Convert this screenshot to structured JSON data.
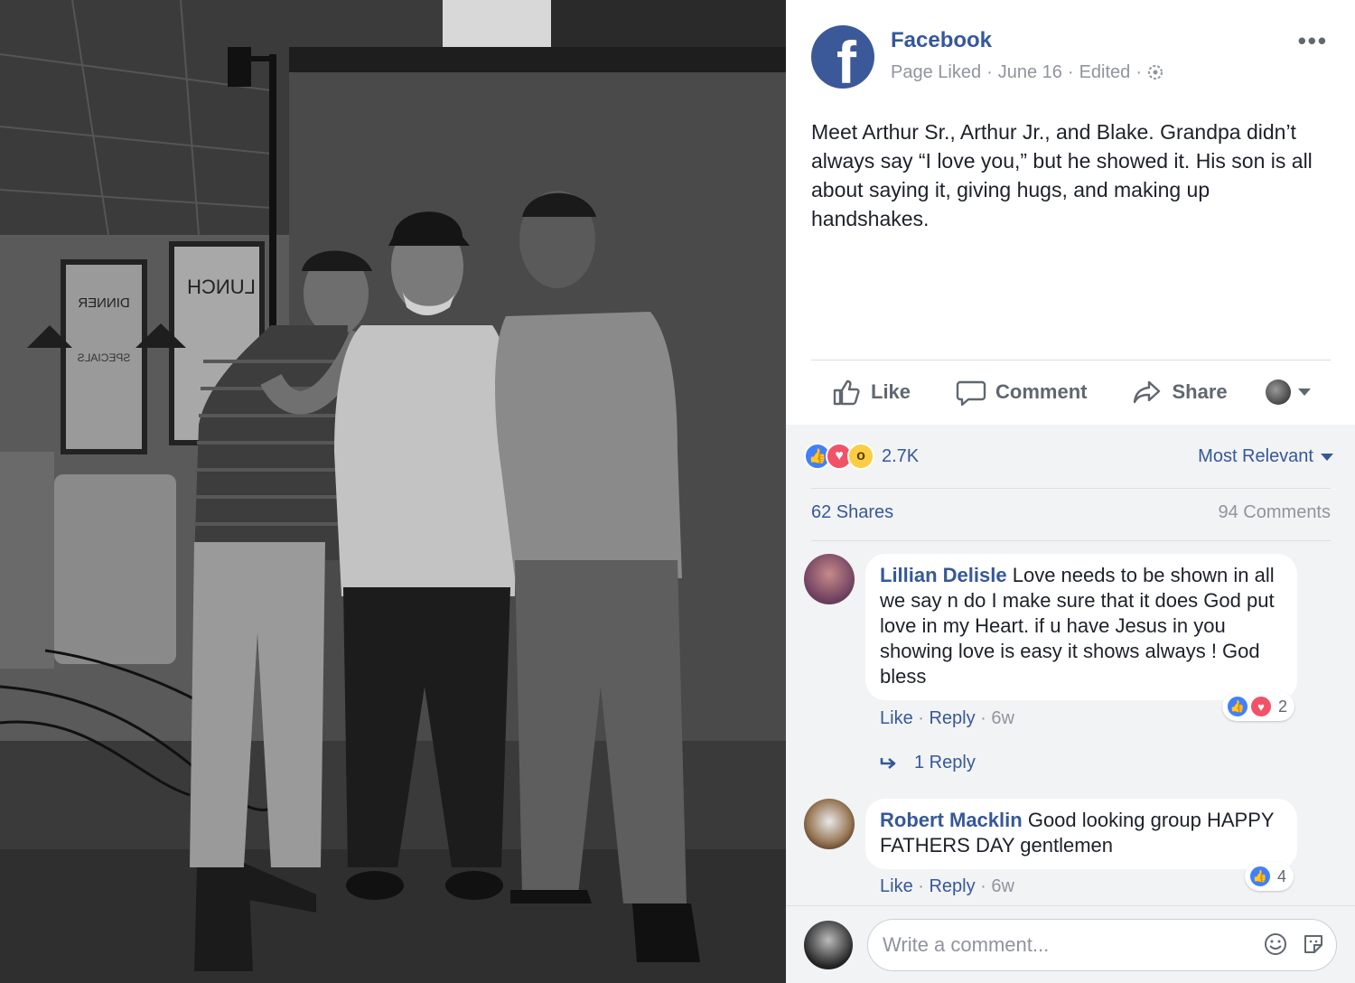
{
  "post": {
    "page_name": "Facebook",
    "logo_letter": "f",
    "status": "Page Liked",
    "date": "June 16",
    "edited": "Edited",
    "sep": "·",
    "more": "•••",
    "text": "Meet Arthur Sr., Arthur Jr., and Blake. Grandpa didn’t always say “I love you,” but he showed it. His son is all about saying it, giving hugs, and making up handshakes."
  },
  "actions": {
    "like": "Like",
    "comment": "Comment",
    "share": "Share"
  },
  "reactions": {
    "count": "2.7K",
    "sort": "Most Relevant",
    "shares": "62 Shares",
    "comments": "94 Comments"
  },
  "comments": [
    {
      "author": "Lillian Delisle",
      "text": "Love needs to be shown in all we say n do I make sure that it does God put love in my Heart. if u have Jesus in you showing love is easy it shows always ! God bless",
      "like": "Like",
      "reply": "Reply",
      "age": "6w",
      "reaction_count": "2",
      "replies_label": "1 Reply"
    },
    {
      "author": "Robert Macklin",
      "text": "Good looking group HAPPY FATHERS DAY gentlemen",
      "like": "Like",
      "reply": "Reply",
      "age": "6w",
      "reaction_count": "4"
    }
  ],
  "composer": {
    "placeholder": "Write a comment..."
  },
  "photo": {
    "sign_lunch": "LUNCH",
    "sign_dinner": "DINNER",
    "sign_specials": "SPECIALS"
  },
  "colors": {
    "brand": "#3b5998",
    "link": "#365899",
    "muted": "#90949c"
  }
}
